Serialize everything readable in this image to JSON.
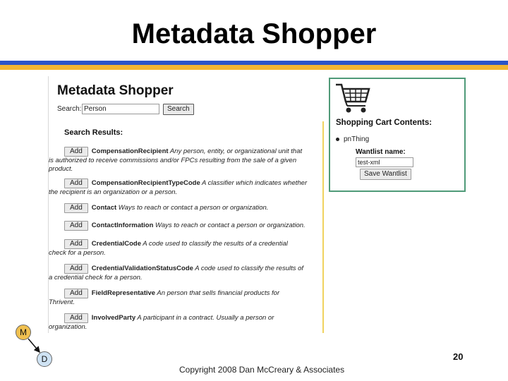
{
  "slide": {
    "title": "Metadata Shopper",
    "page_number": "20",
    "copyright": "Copyright 2008 Dan McCreary & Associates",
    "badges": {
      "m": "M",
      "d": "D"
    },
    "colors": {
      "rule_blue": "#2b55c8",
      "rule_yellow": "#f2b632",
      "cart_border": "#4f9a78"
    }
  },
  "app": {
    "title": "Metadata Shopper",
    "search": {
      "label": "Search:",
      "value": "Person",
      "button": "Search"
    },
    "results_heading": "Search Results:",
    "add_label": "Add",
    "results": [
      {
        "name": "CompensationRecipient",
        "desc": " Any person, entity, or organizational unit that",
        "wrap": "is authorized to receive commissions and/or FPCs resulting from the sale of a given product."
      },
      {
        "name": "CompensationRecipientTypeCode",
        "desc": " A classifier which indicates whether",
        "wrap": "the recipient is an organization or a person."
      },
      {
        "name": "Contact",
        "desc": " Ways to reach or contact a person or organization.",
        "wrap": ""
      },
      {
        "name": "ContactInformation",
        "desc": " Ways to reach or contact a person or organization.",
        "wrap": ""
      },
      {
        "name": "CredentialCode",
        "desc": " A code used to classify the results of a credential",
        "wrap": "check for a person."
      },
      {
        "name": "CredentialValidationStatusCode",
        "desc": " A code used to classify the results of",
        "wrap": "a credential check for a person."
      },
      {
        "name": "FieldRepresentative",
        "desc": " An person that sells financial products for",
        "wrap": "Thrivent."
      },
      {
        "name": "InvolvedParty",
        "desc": " A participant in a contract. Usually a person or",
        "wrap": "organization."
      }
    ]
  },
  "cart": {
    "icon": "shopping-cart-icon",
    "title": "Shopping Cart Contents:",
    "items": [
      "pnThing"
    ],
    "wantlist_label": "Wantlist name:",
    "wantlist_value": "test-xml",
    "save_button": "Save Wantlist"
  }
}
